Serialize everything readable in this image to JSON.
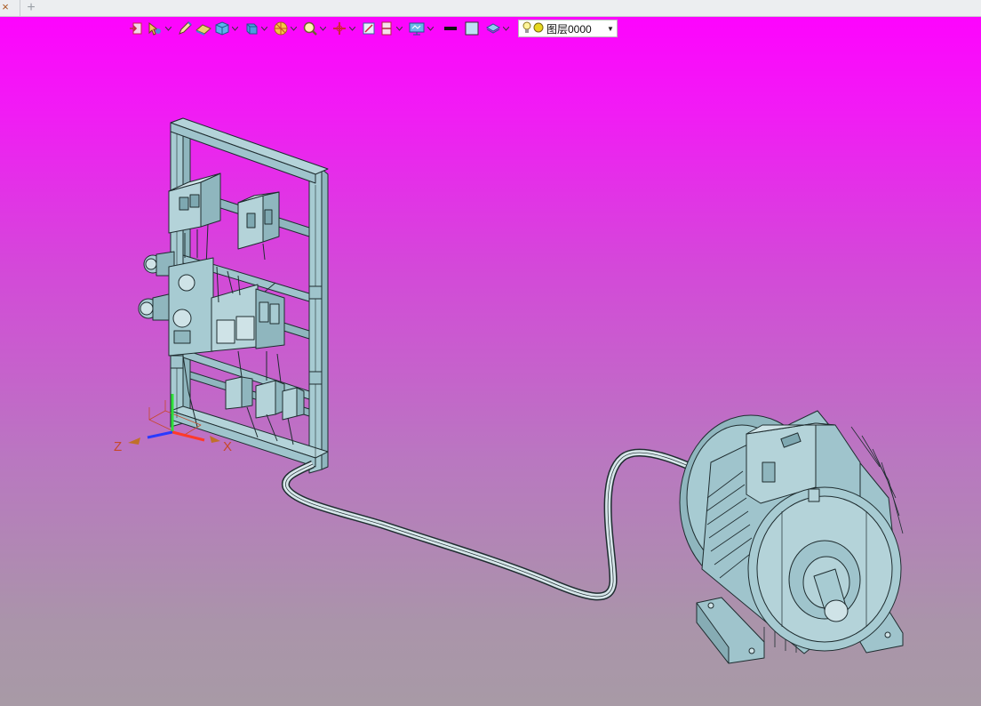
{
  "tabs": {
    "close_glyph": "×",
    "add_glyph": "+"
  },
  "toolbar": {
    "buttons": [
      {
        "icon": "exit-sketch-icon",
        "dropdown": false
      },
      {
        "icon": "select-filter-icon",
        "dropdown": true
      },
      {
        "icon": "pen-icon",
        "dropdown": false
      },
      {
        "icon": "eraser-icon",
        "dropdown": false
      },
      {
        "icon": "solid-cube-icon",
        "dropdown": true
      },
      {
        "icon": "view-orient-icon",
        "dropdown": true
      },
      {
        "icon": "render-style-icon",
        "dropdown": true
      },
      {
        "icon": "zoom-icon",
        "dropdown": true
      },
      {
        "icon": "snap-icon",
        "dropdown": true
      },
      {
        "icon": "section-icon",
        "dropdown": false
      },
      {
        "icon": "clip-plane-icon",
        "dropdown": true
      },
      {
        "icon": "display-monitor-icon",
        "dropdown": true
      },
      {
        "icon": "line-style-icon",
        "dropdown": false
      },
      {
        "icon": "fill-color-icon",
        "dropdown": false
      },
      {
        "icon": "layer-stack-icon",
        "dropdown": true
      }
    ],
    "layer": {
      "name": "图层0000",
      "bulb_color": "#f2e65a",
      "dot_color": "#e6d81f"
    }
  },
  "scene": {
    "axis_labels": {
      "x": "X",
      "z": "Z"
    },
    "colors": {
      "part_fill": "#9fc4cc",
      "part_stroke": "#1f2d30",
      "axis_x": "#ff3a2a",
      "axis_y": "#2ee03a",
      "axis_z": "#2a3aff",
      "axis_box": "#c7482a"
    }
  }
}
